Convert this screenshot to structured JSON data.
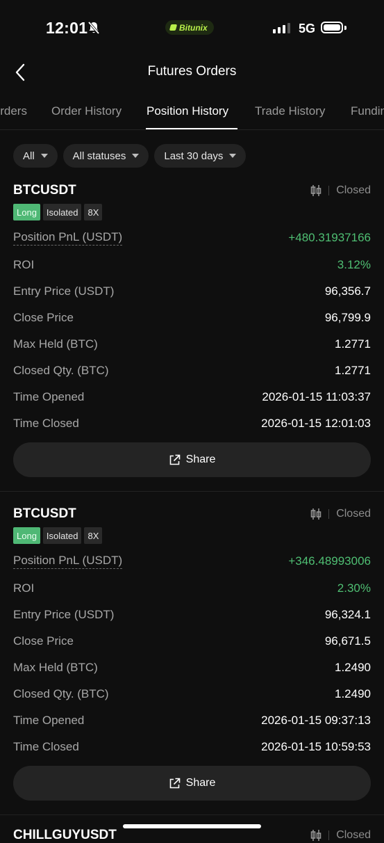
{
  "status_bar": {
    "time": "12:01",
    "network": "5G",
    "brand_pill": "Bitunix"
  },
  "header": {
    "title": "Futures Orders"
  },
  "tabs": [
    {
      "label": "Orders"
    },
    {
      "label": "Order History"
    },
    {
      "label": "Position History",
      "active": true
    },
    {
      "label": "Trade History"
    },
    {
      "label": "Funding"
    }
  ],
  "filters": [
    {
      "label": "All"
    },
    {
      "label": "All statuses"
    },
    {
      "label": "Last 30 days"
    }
  ],
  "colors": {
    "profit": "#4fbf73",
    "long_tag": "#4fb875",
    "background": "#0f0f0f"
  },
  "positions": [
    {
      "symbol": "BTCUSDT",
      "status": "Closed",
      "side": "Long",
      "margin_mode": "Isolated",
      "leverage": "8X",
      "rows": [
        {
          "label": "Position PnL (USDT)",
          "value": "+480.31937166"
        },
        {
          "label": "ROI",
          "value": "3.12%"
        },
        {
          "label": "Entry Price (USDT)",
          "value": "96,356.7"
        },
        {
          "label": "Close Price",
          "value": "96,799.9"
        },
        {
          "label": "Max Held (BTC)",
          "value": "1.2771"
        },
        {
          "label": "Closed Qty. (BTC)",
          "value": "1.2771"
        },
        {
          "label": "Time Opened",
          "value": "2026-01-15 11:03:37"
        },
        {
          "label": "Time Closed",
          "value": "2026-01-15 12:01:03"
        }
      ],
      "share_label": "Share"
    },
    {
      "symbol": "BTCUSDT",
      "status": "Closed",
      "side": "Long",
      "margin_mode": "Isolated",
      "leverage": "8X",
      "rows": [
        {
          "label": "Position PnL (USDT)",
          "value": "+346.48993006"
        },
        {
          "label": "ROI",
          "value": "2.30%"
        },
        {
          "label": "Entry Price (USDT)",
          "value": "96,324.1"
        },
        {
          "label": "Close Price",
          "value": "96,671.5"
        },
        {
          "label": "Max Held (BTC)",
          "value": "1.2490"
        },
        {
          "label": "Closed Qty. (BTC)",
          "value": "1.2490"
        },
        {
          "label": "Time Opened",
          "value": "2026-01-15 09:37:13"
        },
        {
          "label": "Time Closed",
          "value": "2026-01-15 10:59:53"
        }
      ],
      "share_label": "Share"
    }
  ],
  "partial_next": {
    "symbol": "CHILLGUYUSDT",
    "status": "Closed"
  }
}
